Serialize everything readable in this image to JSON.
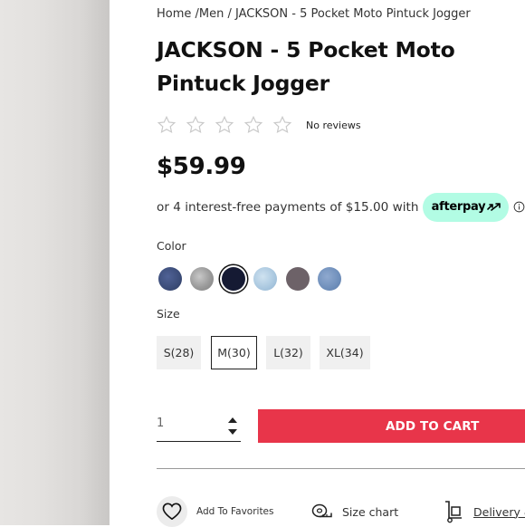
{
  "breadcrumb": {
    "home": "Home",
    "sep1": " /",
    "category": "Men",
    "sep2": " / ",
    "current": "JACKSON - 5 Pocket Moto Pintuck Jogger"
  },
  "product": {
    "title": "JACKSON - 5 Pocket Moto Pintuck Jogger",
    "rating": {
      "stars_filled": 0,
      "stars_total": 5,
      "reviews_text": "No reviews"
    },
    "price": "$59.99"
  },
  "afterpay": {
    "text": "or 4 interest-free payments of $15.00 with",
    "brand": "afterpay",
    "icon": "info-icon"
  },
  "color": {
    "label": "Color",
    "selected_index": 2,
    "swatches": [
      {
        "name": "dark-indigo",
        "color": "#3b4c78"
      },
      {
        "name": "grey-speckle",
        "color": "#9a9a9a"
      },
      {
        "name": "navy",
        "color": "#151a33"
      },
      {
        "name": "light-wash",
        "color": "#a9c7df"
      },
      {
        "name": "taupe",
        "color": "#6d6268"
      },
      {
        "name": "medium-wash",
        "color": "#6f8fbb"
      }
    ]
  },
  "size": {
    "label": "Size",
    "selected_index": 1,
    "options": [
      "S(28)",
      "M(30)",
      "L(32)",
      "XL(34)"
    ]
  },
  "quantity": {
    "value": "1"
  },
  "cart": {
    "label": "ADD TO CART"
  },
  "actions": {
    "favorites": "Add To Favorites",
    "size_chart": "Size chart",
    "delivery": "Delivery &"
  },
  "colors": {
    "accent": "#e8354a",
    "afterpay_mint": "#b2fce4"
  }
}
